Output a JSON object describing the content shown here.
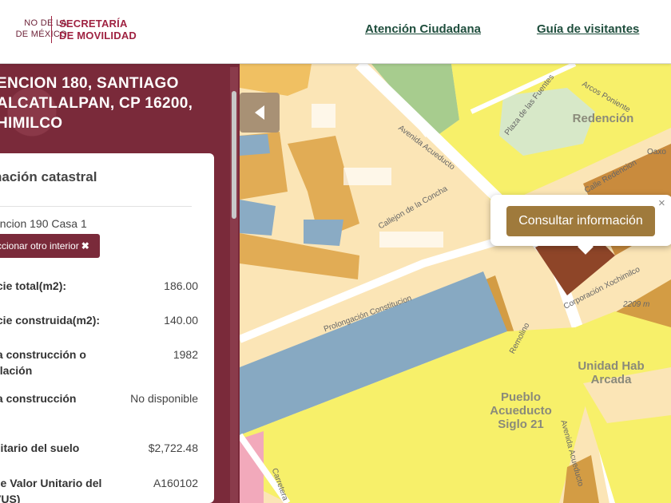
{
  "header": {
    "gov_line1": "NO DE LA",
    "gov_line2": "DE MÉXICO",
    "secretaria_line1": "SECRETARÍA",
    "secretaria_line2": "DE MOVILIDAD",
    "nav": [
      {
        "label": "Atención Ciudadana"
      },
      {
        "label": "Guía de visitantes"
      }
    ]
  },
  "panel": {
    "address_lines": [
      "ENCION 180, SANTIAGO",
      "ALCATLALPAN, CP 16200,",
      "HIMILCO"
    ],
    "card_title": "nación catastral",
    "interior": "encion 190 Casa 1",
    "select_button": "ccionar otro interior",
    "select_button_icon": "✖",
    "rows": [
      {
        "label": "icie total(m2):",
        "value": "186.00"
      },
      {
        "label": "icie construida(m2):",
        "value": "140.00"
      },
      {
        "label": "la construcción o elación",
        "value": "1982"
      },
      {
        "label": "la construcción",
        "value": "No disponible"
      },
      {
        "label": "nitario del suelo",
        "value": "$2,722.48"
      },
      {
        "label": "de Valor Unitario del VUS)",
        "value": "A160102"
      }
    ]
  },
  "map": {
    "popup_button": "Consultar información",
    "popup_close": "×",
    "streets": {
      "avenida_acueducto_top": "Avenida Acueducto",
      "avenida_acueducto_right": "Avenida Acueducto",
      "plaza_fuentes": "Plaza de las Fuentes",
      "arcos_poniente": "Arcos Poniente",
      "calle_redencion": "Calle Redencion",
      "callejon": "Callejon de la Concha",
      "prolongacion": "Prolongación Constitucion",
      "corporacion": "Corporación Xochimilco",
      "remolino": "Remolino",
      "carretera": "Carretera",
      "oaxo": "Oaxo",
      "height": "2209 m"
    },
    "areas": {
      "redencion": "Redención",
      "unidad_hab": "Unidad Hab Arcada",
      "pueblo": "Pueblo Acueducto Siglo 21"
    }
  }
}
